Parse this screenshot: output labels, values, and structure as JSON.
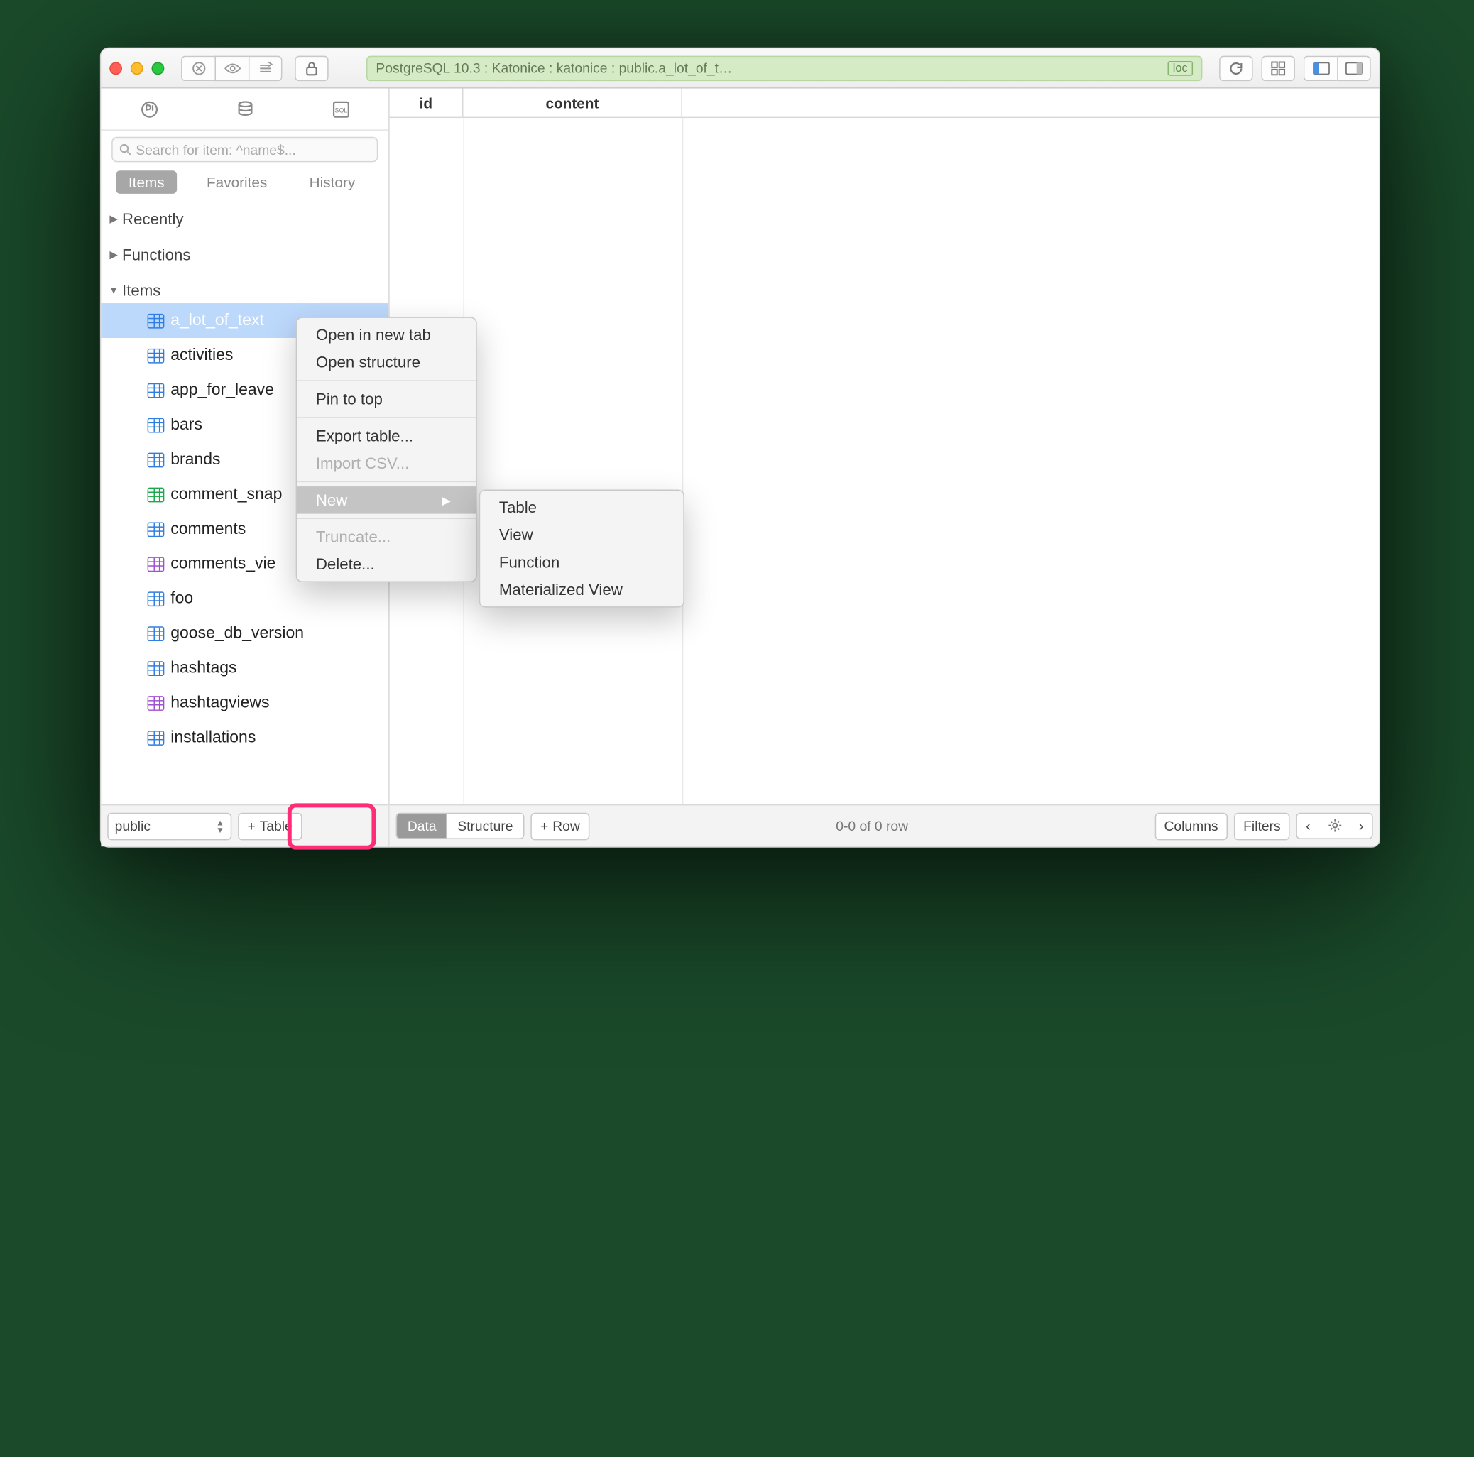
{
  "breadcrumb": "PostgreSQL 10.3 : Katonice : katonice : public.a_lot_of_t…",
  "loc_badge": "loc",
  "search_placeholder": "Search for item: ^name$...",
  "sidebar_tabs": {
    "items": "Items",
    "favorites": "Favorites",
    "history": "History"
  },
  "tree": {
    "recently": "Recently",
    "functions": "Functions",
    "items_label": "Items",
    "items": [
      {
        "name": "a_lot_of_text",
        "icon": "blue",
        "selected": true
      },
      {
        "name": "activities",
        "icon": "blue"
      },
      {
        "name": "app_for_leave",
        "icon": "blue"
      },
      {
        "name": "bars",
        "icon": "blue"
      },
      {
        "name": "brands",
        "icon": "blue"
      },
      {
        "name": "comment_snap",
        "icon": "green"
      },
      {
        "name": "comments",
        "icon": "blue"
      },
      {
        "name": "comments_vie",
        "icon": "purple"
      },
      {
        "name": "foo",
        "icon": "blue"
      },
      {
        "name": "goose_db_version",
        "icon": "blue"
      },
      {
        "name": "hashtags",
        "icon": "blue"
      },
      {
        "name": "hashtagviews",
        "icon": "purple"
      },
      {
        "name": "installations",
        "icon": "blue"
      }
    ]
  },
  "schema": "public",
  "add_button": "Table",
  "columns": {
    "id": "id",
    "content": "content"
  },
  "context_menu": {
    "open_tab": "Open in new tab",
    "open_structure": "Open structure",
    "pin": "Pin to top",
    "export": "Export table...",
    "import": "Import CSV...",
    "new": "New",
    "truncate": "Truncate...",
    "delete": "Delete..."
  },
  "submenu": {
    "table": "Table",
    "view": "View",
    "function": "Function",
    "mview": "Materialized View"
  },
  "footer": {
    "data": "Data",
    "structure": "Structure",
    "row": "Row",
    "status": "0-0 of 0 row",
    "columns": "Columns",
    "filters": "Filters"
  }
}
